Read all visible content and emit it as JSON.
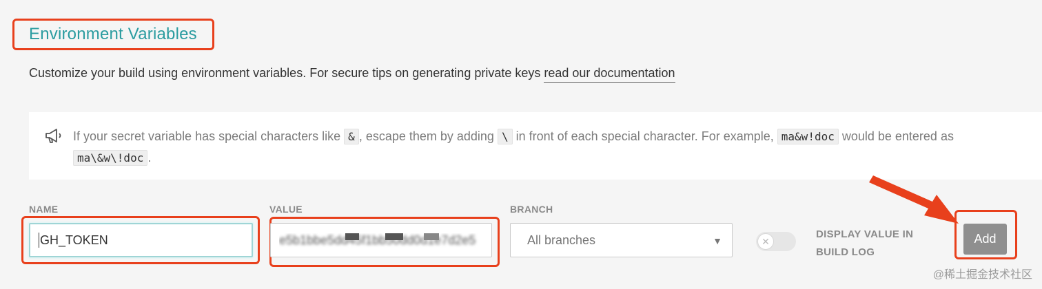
{
  "title": "Environment Variables",
  "intro": {
    "text": "Customize your build using environment variables. For secure tips on generating private keys ",
    "link": "read our documentation"
  },
  "notice": {
    "icon": "megaphone-icon",
    "part1": "If your secret variable has special characters like ",
    "code1": "&",
    "part2": ", escape them by adding ",
    "code2": "\\",
    "part3": " in front of each special character. For example, ",
    "code3": "ma&w!doc",
    "part4": " would be entered as",
    "code4": "ma\\&w\\!doc",
    "part5": "."
  },
  "form": {
    "name_label": "NAME",
    "name_value": "GH_TOKEN",
    "value_label": "VALUE",
    "value_value": "e5b1bbe5dd45f1bb50dd0d1e7d2e5",
    "branch_label": "BRANCH",
    "branch_value": "All branches",
    "display_label_line1": "DISPLAY VALUE IN",
    "display_label_line2": "BUILD LOG",
    "toggle_on": false,
    "add_label": "Add"
  },
  "watermark": "@稀土掘金技术社区",
  "colors": {
    "accent": "#2b9ca0",
    "highlight": "#e8401c",
    "button": "#8f8f8f"
  }
}
